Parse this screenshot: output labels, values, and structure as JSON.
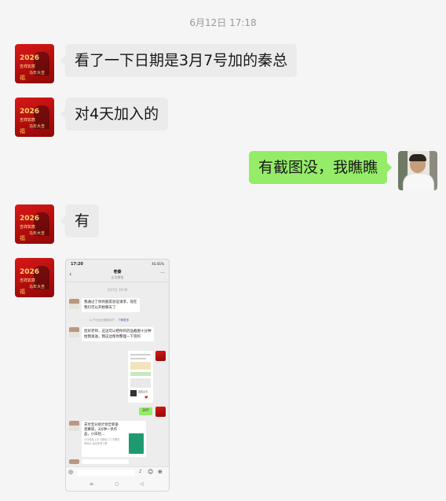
{
  "timestamp": "6月12日 17:18",
  "messages": [
    {
      "side": "left",
      "text": "看了一下日期是3月7号加的秦总"
    },
    {
      "side": "left",
      "text": "对4天加入的"
    },
    {
      "side": "right",
      "text": "有截图没，我瞧瞧"
    },
    {
      "side": "left",
      "text": "有"
    }
  ],
  "avatar_badge": {
    "year": "2026",
    "line1": "吉祥如意",
    "line2": "马年大吉",
    "symbol": "福"
  },
  "screenshot": {
    "time": "17:20",
    "status": "4G 81%",
    "contact_name": "老秦",
    "contact_sub": "企业微信",
    "date": "3月7日 16:40",
    "msg1": "我通过了你的朋友验证请求，现在我们可以开始聊天了",
    "note": "以下为企业微信用户，",
    "note_link": "了解更多",
    "msg2": "您好老师，这边可以把你的药品截图十分钟给我发送，我这边帮你整理一下资料",
    "img_caption": "返回主页",
    "green_text": "207",
    "msg3": "支付宝分组计划全新垂直赛道，3分钟一条作品，小白轻…",
    "msg3_sub": "小白轻松上手 0基础入门 不限时间地点 适合所有人群"
  },
  "colors": {
    "left_bubble": "#ebebeb",
    "right_bubble": "#95ec69",
    "background": "#f5f5f5"
  }
}
